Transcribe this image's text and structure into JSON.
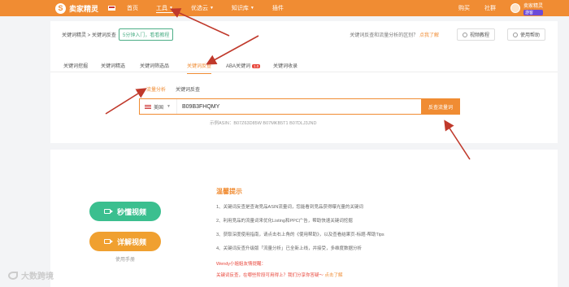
{
  "topbar": {
    "logo_text": "卖家精灵",
    "nav": [
      "首页",
      "工具",
      "优选云",
      "知识库",
      "插件"
    ],
    "right": [
      "购买",
      "社群"
    ],
    "user_name": "卖家精灵",
    "user_badge": "游客"
  },
  "breadcrumb": "关键词精灵 > 关键词反查",
  "tag_button": "5分钟入门，看看教程",
  "hint_text": "关键词反查和流量分析的区别？",
  "hint_link": "点我了解",
  "buttons": {
    "video": "视频教程",
    "help": "使用帮助"
  },
  "tabs": [
    {
      "label": "关键词挖掘",
      "active": false
    },
    {
      "label": "关键词精选",
      "active": false
    },
    {
      "label": "关键词筛选品",
      "active": false
    },
    {
      "label": "关键词反查",
      "active": true
    },
    {
      "label": "ABA关键词",
      "active": false,
      "badge": "1.0"
    },
    {
      "label": "关键词收录",
      "active": false
    }
  ],
  "subtabs": [
    {
      "label": "流量分析",
      "active": true
    },
    {
      "label": "关键词反查",
      "active": false
    }
  ],
  "search": {
    "country": "美国",
    "value": "B09B3FHQMY",
    "button": "反查流量词"
  },
  "example": "示例ASIN：B07Z63D85W  B07MKB5T1  B07DLJ3JND",
  "videos": {
    "green": "秒懂视频",
    "orange": "详解视频",
    "manual": "使用手册"
  },
  "tips": {
    "title": "温馨提示",
    "items": [
      "1、关键词反查是查询竞品ASIN流量词，您能看到竞品获得曝光量的关键词",
      "2、利用竞品的流量词来优化Listing和PPC广告，帮助快速关键词挖掘",
      "3、获取深度使用指南，请点击右上角的《使用帮助》，以及查看结果页-标题-帮助Tips",
      "4、关键词反查升级版「流量分析」已全新上线，并接受，多维度数据分析"
    ],
    "wendy": "Wendy小姐姐友情提醒：",
    "red_line": "关键词反查，在哪些阶段可用得上？我们分享你答疑～",
    "red_link": "点击了解"
  },
  "watermark": "大数跨境"
}
